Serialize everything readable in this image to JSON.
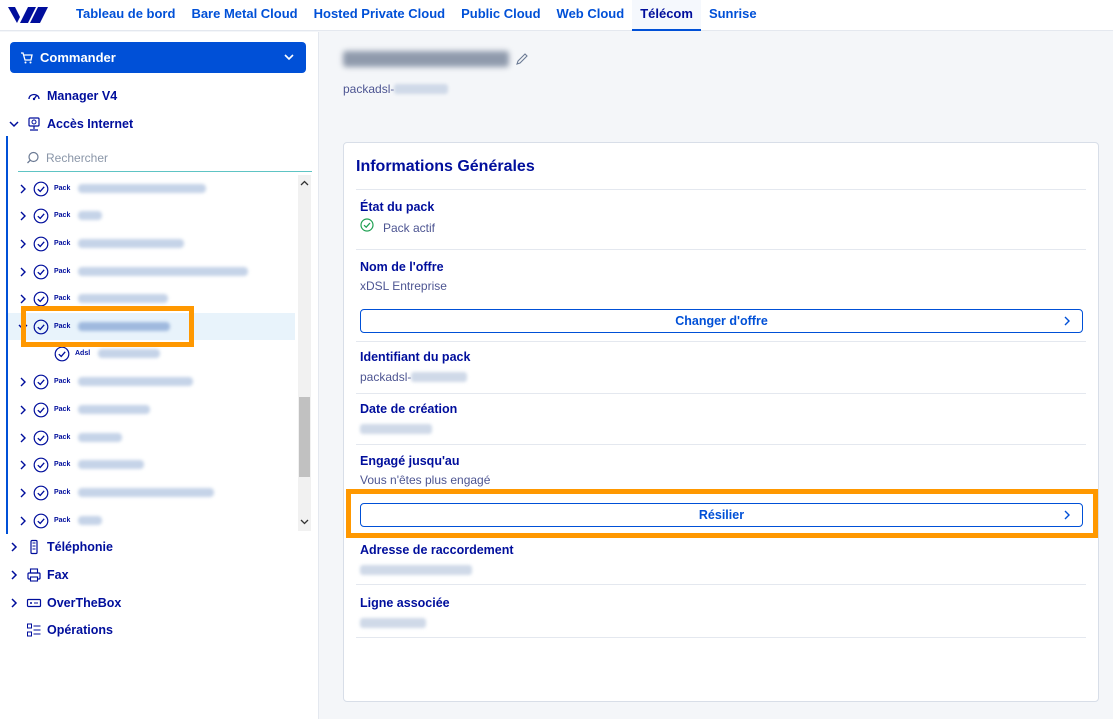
{
  "nav": {
    "logo": "ovh-logo",
    "tabs": [
      "Tableau de bord",
      "Bare Metal Cloud",
      "Hosted Private Cloud",
      "Public Cloud",
      "Web Cloud",
      "Télécom",
      "Sunrise"
    ],
    "active_tab": "Télécom"
  },
  "sidebar": {
    "order_label": "Commander",
    "manager_v4": "Manager V4",
    "internet_access": "Accès Internet",
    "search_placeholder": "Rechercher",
    "pack_tag": "Pack",
    "adsl_tag": "Adsl",
    "telephony": "Téléphonie",
    "fax": "Fax",
    "overthebox": "OverTheBox",
    "operations": "Opérations"
  },
  "main": {
    "service_prefix": "packadsl-",
    "card_title": "Informations Générales",
    "pack_state_label": "État du pack",
    "pack_state_value": "Pack actif",
    "offer_name_label": "Nom de l'offre",
    "offer_name_value": "xDSL Entreprise",
    "change_offer_button": "Changer d'offre",
    "pack_id_label": "Identifiant du pack",
    "pack_id_prefix": "packadsl-",
    "creation_date_label": "Date de création",
    "engaged_label": "Engagé jusqu'au",
    "engaged_value": "Vous n'êtes plus engagé",
    "terminate_button": "Résilier",
    "address_label": "Adresse de raccordement",
    "line_label": "Ligne associée"
  },
  "colors": {
    "primary": "#0050d7",
    "text_dark": "#000e9c",
    "highlight": "#ff9800",
    "success": "#1fa052"
  }
}
